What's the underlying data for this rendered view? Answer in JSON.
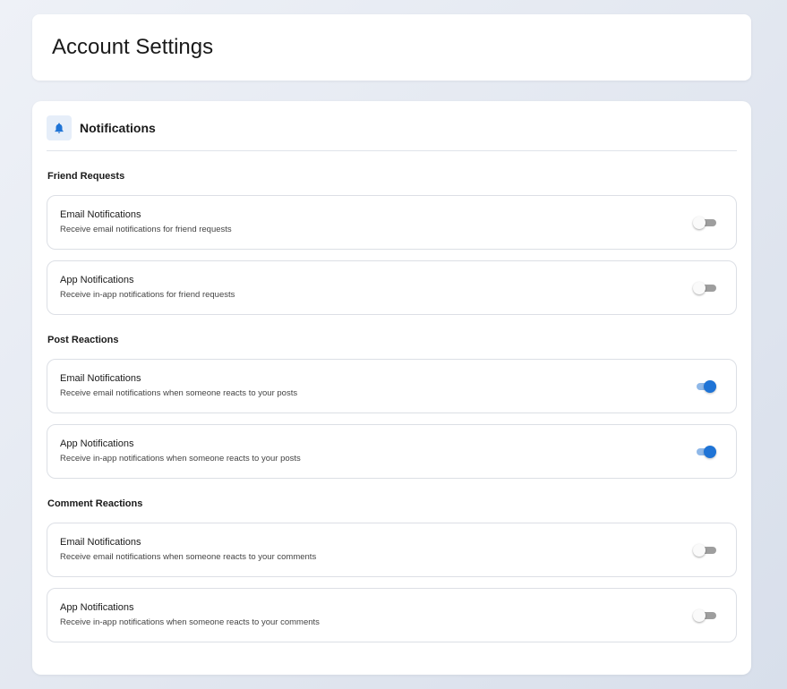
{
  "page": {
    "title": "Account Settings"
  },
  "panel": {
    "title": "Notifications",
    "icon": "bell-icon",
    "accent": "#1f74d6"
  },
  "sections": [
    {
      "title": "Friend Requests",
      "rows": [
        {
          "title": "Email Notifications",
          "description": "Receive email notifications for friend requests",
          "enabled": false
        },
        {
          "title": "App Notifications",
          "description": "Receive in-app notifications for friend requests",
          "enabled": false
        }
      ]
    },
    {
      "title": "Post Reactions",
      "rows": [
        {
          "title": "Email Notifications",
          "description": "Receive email notifications when someone reacts to your posts",
          "enabled": true
        },
        {
          "title": "App Notifications",
          "description": "Receive in-app notifications when someone reacts to your posts",
          "enabled": true
        }
      ]
    },
    {
      "title": "Comment Reactions",
      "rows": [
        {
          "title": "Email Notifications",
          "description": "Receive email notifications when someone reacts to your comments",
          "enabled": false
        },
        {
          "title": "App Notifications",
          "description": "Receive in-app notifications when someone reacts to your comments",
          "enabled": false
        }
      ]
    }
  ]
}
